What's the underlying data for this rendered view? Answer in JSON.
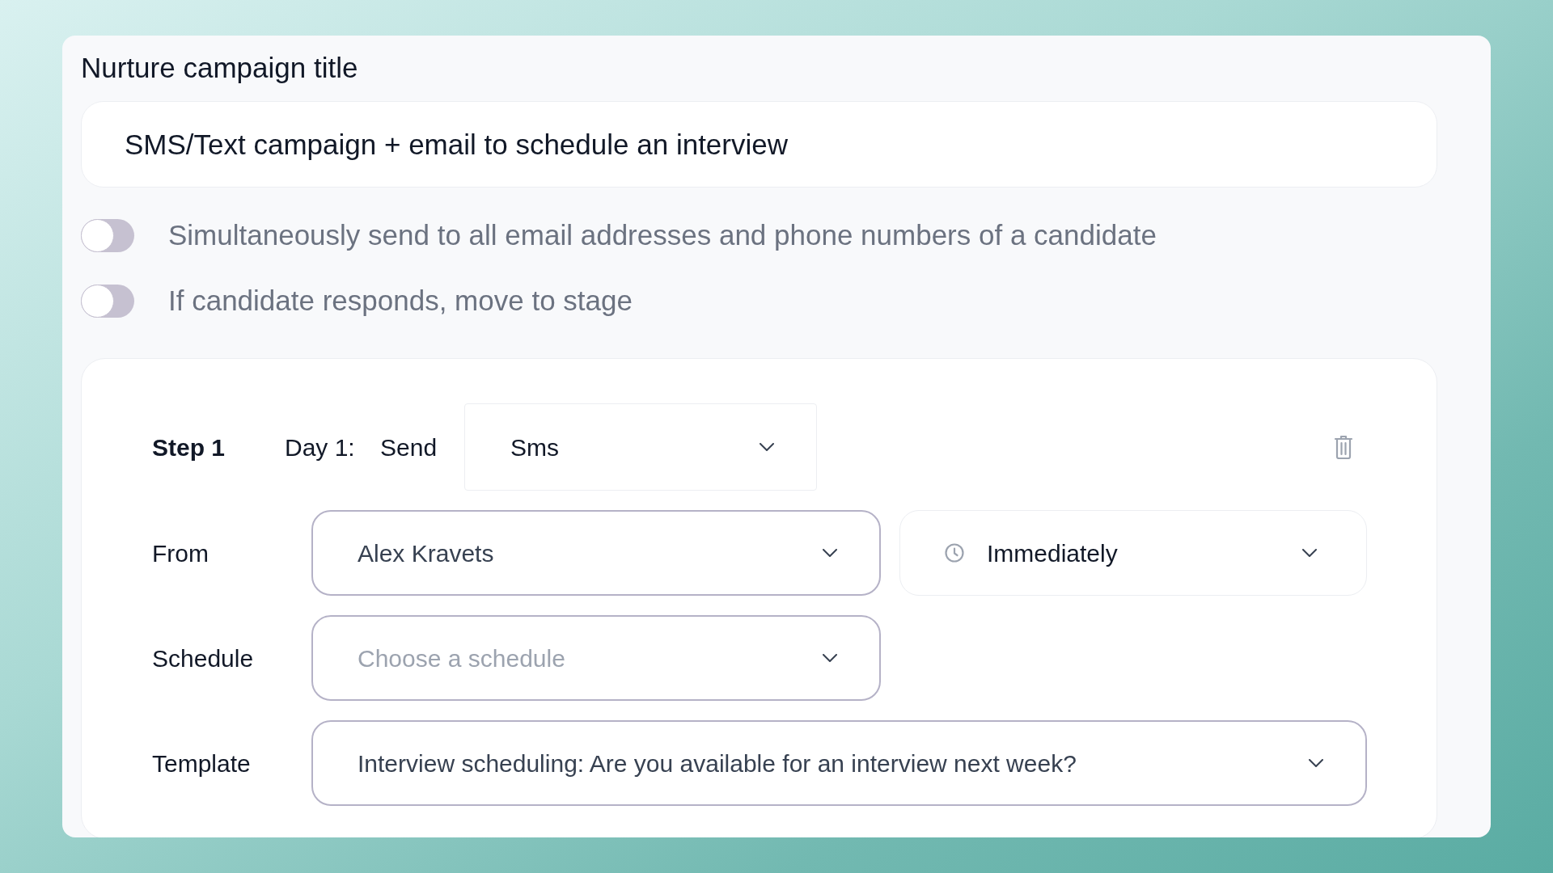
{
  "form": {
    "title_label": "Nurture campaign title",
    "title_input": {
      "value": "SMS/Text campaign + email to schedule an interview"
    }
  },
  "toggles": [
    {
      "label": "Simultaneously send to all email addresses and phone numbers of a candidate",
      "on": false
    },
    {
      "label": "If candidate responds, move to stage",
      "on": false
    }
  ],
  "steps": [
    {
      "step_label": "Step 1",
      "day_label": "Day 1:",
      "action_label": "Send",
      "channel": {
        "value": "Sms"
      },
      "fields": [
        {
          "label": "From",
          "kind": "half",
          "value": "Alex Kravets",
          "timing": {
            "value": "Immediately"
          }
        },
        {
          "label": "Schedule",
          "kind": "half",
          "placeholder": "Choose a schedule"
        },
        {
          "label": "Template",
          "kind": "full",
          "value": "Interview scheduling: Are you available for an interview next week?"
        }
      ]
    }
  ]
}
